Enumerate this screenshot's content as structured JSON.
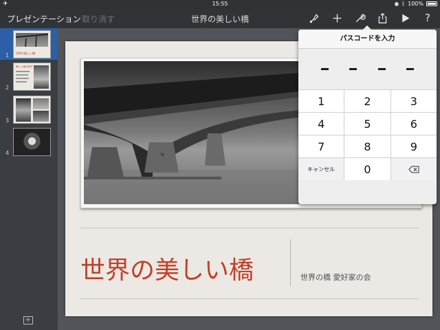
{
  "status_bar": {
    "time": "15:55",
    "battery": "100%",
    "airplane_icon": "airplane-icon",
    "location_icon": "location-icon",
    "bluetooth_icon": "bluetooth-icon"
  },
  "toolbar": {
    "back_label": "プレゼンテーション",
    "undo_label": "取り消す",
    "document_title": "世界の美しい橋",
    "icons": [
      "format-brush-icon",
      "add-icon",
      "wrench-icon",
      "share-icon",
      "play-icon",
      "help-icon"
    ]
  },
  "navigator": {
    "slides": [
      {
        "number": "1",
        "thumb_title": "世界の美しい橋",
        "selected": true
      },
      {
        "number": "2",
        "thumb_title": "美しい橋の条件",
        "selected": false
      },
      {
        "number": "3",
        "selected": false
      },
      {
        "number": "4",
        "selected": false
      }
    ],
    "add_label": "+"
  },
  "slide": {
    "title": "世界の美しい橋",
    "subtitle": "世界の橋 愛好家の会",
    "photo_caption": "N"
  },
  "passcode": {
    "header": "パスコードを入力",
    "digit_placeholder": "–",
    "keys": {
      "k1": "1",
      "k2": "2",
      "k3": "3",
      "k4": "4",
      "k5": "5",
      "k6": "6",
      "k7": "7",
      "k8": "8",
      "k9": "9",
      "cancel": "キャンセル",
      "k0": "0",
      "delete_icon": "backspace-icon"
    }
  },
  "colors": {
    "accent": "#c2402a",
    "selection": "#2c5fa8",
    "toolbar": "#313437"
  }
}
